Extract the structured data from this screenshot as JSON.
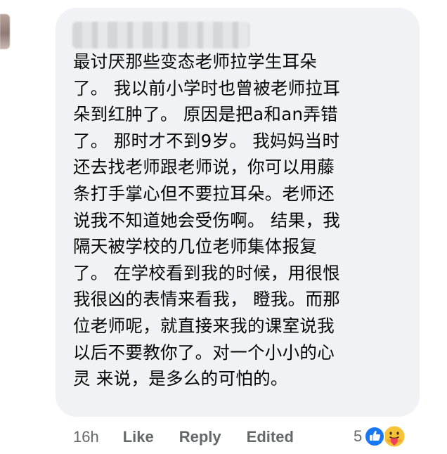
{
  "comment": {
    "author_name": "",
    "text": "最讨厌那些变态老师拉学生耳朵\n了。 我以前小学时也曾被老师拉耳\n朵到红肿了。 原因是把a和an弄错\n了。 那时才不到9岁。 我妈妈当时\n还去找老师跟老师说，你可以用藤\n条打手掌心但不要拉耳朵。老师还\n说我不知道她会受伤啊。 结果，我\n隔天被学校的几位老师集体报复\n了。 在学校看到我的时候，用很恨\n我很凶的表情来看我， 瞪我。而那\n位老师呢，就直接来我的课室说我\n以后不要教你了。对一个小小的心\n灵 来说，是多么的可怕的。"
  },
  "actions": {
    "timestamp": "16h",
    "like_label": "Like",
    "reply_label": "Reply",
    "edited_label": "Edited"
  },
  "reactions": {
    "count": "5",
    "icons": [
      "like-icon",
      "care-icon"
    ]
  },
  "colors": {
    "bubble_bg": "#f0f2f5",
    "text": "#050505",
    "meta": "#65676b",
    "like_blue": "#1877f2",
    "care_yellow": "#f7c338"
  }
}
